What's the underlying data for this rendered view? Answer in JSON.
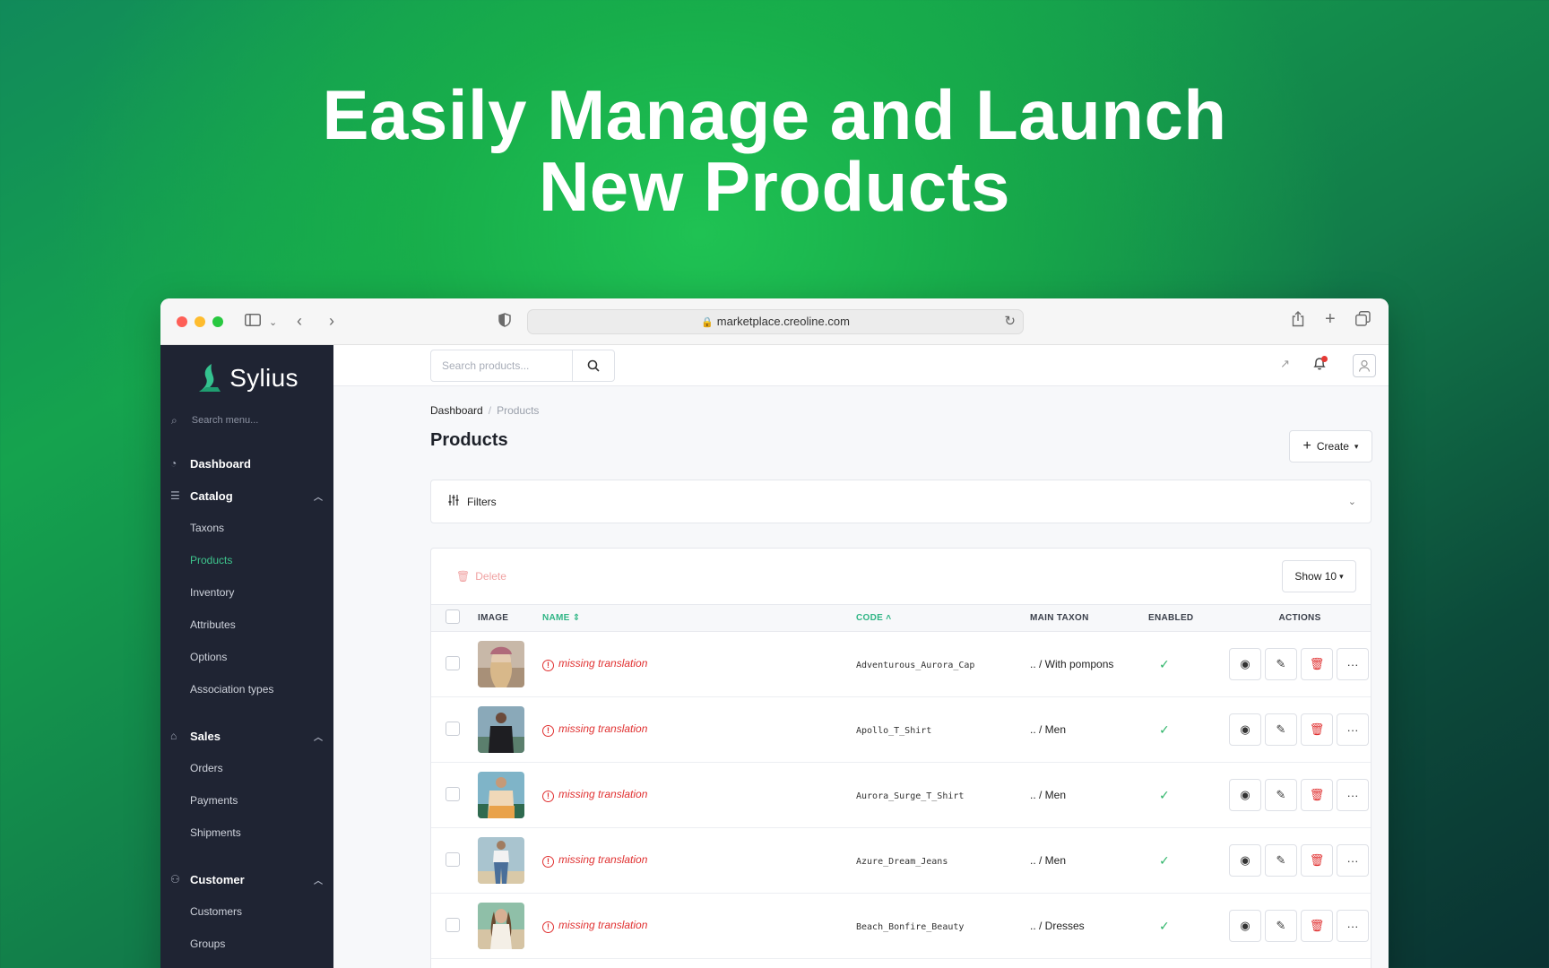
{
  "hero": {
    "line1": "Easily Manage and Launch",
    "line2": "New Products"
  },
  "browser": {
    "url": "marketplace.creoline.com"
  },
  "sidebar": {
    "brand": "Sylius",
    "search_placeholder": "Search menu...",
    "dashboard": "Dashboard",
    "catalog": {
      "label": "Catalog",
      "items": [
        "Taxons",
        "Products",
        "Inventory",
        "Attributes",
        "Options",
        "Association types"
      ]
    },
    "sales": {
      "label": "Sales",
      "items": [
        "Orders",
        "Payments",
        "Shipments"
      ]
    },
    "customer": {
      "label": "Customer",
      "items": [
        "Customers",
        "Groups"
      ]
    }
  },
  "topbar": {
    "search_placeholder": "Search products..."
  },
  "breadcrumb": {
    "home": "Dashboard",
    "sep": "/",
    "current": "Products"
  },
  "page": {
    "title": "Products",
    "create_label": "Create"
  },
  "filters": {
    "label": "Filters"
  },
  "grid": {
    "delete_label": "Delete",
    "show_label": "Show 10",
    "columns": {
      "image": "IMAGE",
      "name": "NAME",
      "code": "CODE",
      "main_taxon": "MAIN TAXON",
      "enabled": "ENABLED",
      "actions": "ACTIONS"
    },
    "rows": [
      {
        "name": "missing translation",
        "code": "Adventurous_Aurora_Cap",
        "taxon": ".. / With pompons",
        "enabled": "✓"
      },
      {
        "name": "missing translation",
        "code": "Apollo_T_Shirt",
        "taxon": ".. / Men",
        "enabled": "✓"
      },
      {
        "name": "missing translation",
        "code": "Aurora_Surge_T_Shirt",
        "taxon": ".. / Men",
        "enabled": "✓"
      },
      {
        "name": "missing translation",
        "code": "Azure_Dream_Jeans",
        "taxon": ".. / Men",
        "enabled": "✓"
      },
      {
        "name": "missing translation",
        "code": "Beach_Bonfire_Beauty",
        "taxon": ".. / Dresses",
        "enabled": "✓"
      }
    ]
  },
  "colors": {
    "accent": "#3ec58d",
    "danger": "#e03131",
    "sidebar_bg": "#1f2433"
  }
}
